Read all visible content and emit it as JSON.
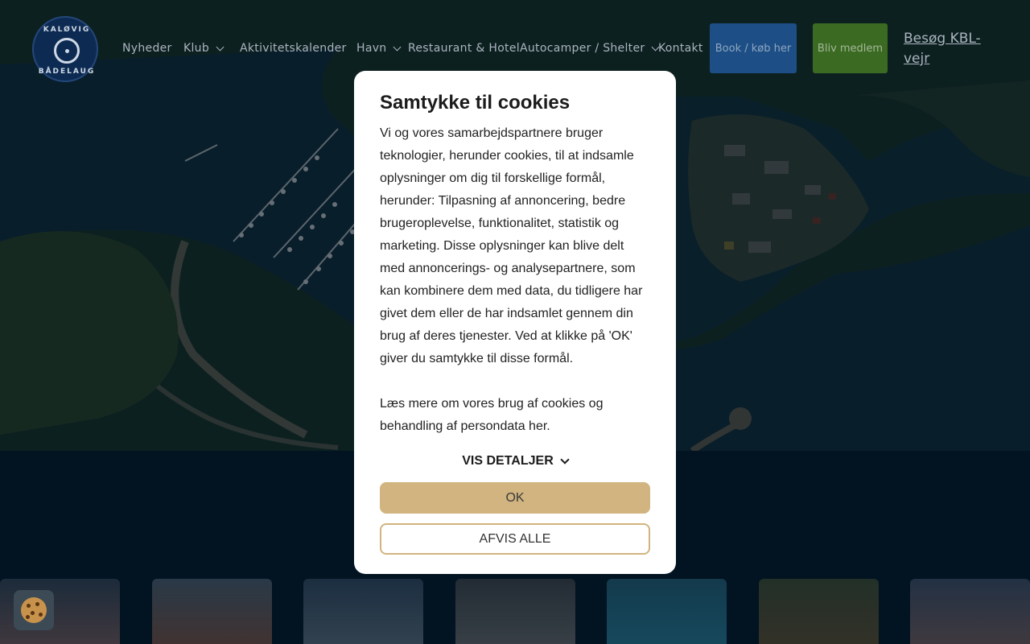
{
  "logo": {
    "top_text": "KALØVIG",
    "bottom_text": "BÅDELAUG"
  },
  "nav": {
    "items": [
      {
        "label": "Nyheder",
        "has_dropdown": false
      },
      {
        "label": "Klub",
        "has_dropdown": true
      },
      {
        "label": "Aktivitetskalender",
        "has_dropdown": false
      },
      {
        "label": "Havn",
        "has_dropdown": true
      },
      {
        "label": "Restaurant & Hotel",
        "has_dropdown": false
      },
      {
        "label": "Autocamper / Shelter",
        "has_dropdown": true
      },
      {
        "label": "Kontakt",
        "has_dropdown": false
      }
    ],
    "book_label": "Book / køb her",
    "member_label": "Bliv medlem",
    "weather_label": " Besøg KBL-vejr"
  },
  "cookie_modal": {
    "title": "Samtykke til cookies",
    "body": "Vi og vores samarbejdspartnere bruger teknologier, herunder cookies, til at indsamle oplysninger om dig til forskellige formål, herunder: Tilpasning af annoncering, bedre brugeroplevelse, funktionalitet, statistik og marketing. Disse oplysninger kan blive delt med annoncerings- og analysepartnere, som kan kombinere dem med data, du tidligere har givet dem eller de har indsamlet gennem din brug af deres tjenester. Ved at klikke på 'OK' giver du samtykke til disse formål.",
    "more_info": "Læs mere om vores brug af cookies og behandling af persondata her.",
    "details_label": "VIS DETALJER",
    "ok_label": "OK",
    "reject_label": "AFVIS ALLE"
  },
  "colors": {
    "page_bg": "#03192a",
    "book_button": "#1d4f86",
    "member_button": "#3b6a22",
    "ok_button": "#d1b47f"
  }
}
